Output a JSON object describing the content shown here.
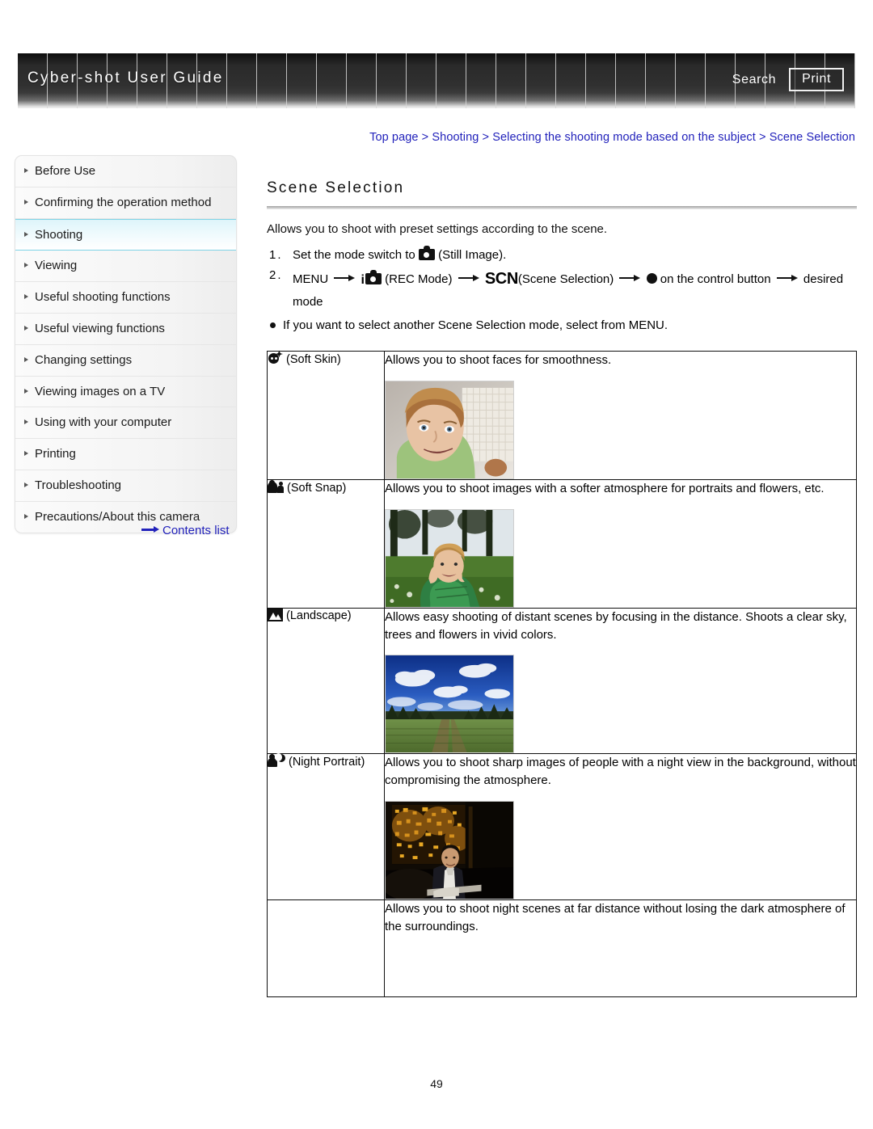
{
  "header": {
    "title": "Cyber-shot User Guide",
    "search_label": "Search",
    "print_label": "Print"
  },
  "breadcrumb": {
    "items": [
      "Top page",
      "Shooting",
      "Selecting the shooting mode based on the subject",
      "Scene Selection"
    ],
    "separator": " > ",
    "full_text": "Top page > Shooting > Selecting the shooting mode based on the subject > Scene Selection",
    "color": "#2222bb"
  },
  "sidebar": {
    "items": [
      {
        "label": "Before Use",
        "active": false
      },
      {
        "label": "Confirming the operation method",
        "active": false
      },
      {
        "label": "Shooting",
        "active": true
      },
      {
        "label": "Viewing",
        "active": false
      },
      {
        "label": "Useful shooting functions",
        "active": false
      },
      {
        "label": "Useful viewing functions",
        "active": false
      },
      {
        "label": "Changing settings",
        "active": false
      },
      {
        "label": "Viewing images on a TV",
        "active": false
      },
      {
        "label": "Using with your computer",
        "active": false
      },
      {
        "label": "Printing",
        "active": false
      },
      {
        "label": "Troubleshooting",
        "active": false
      },
      {
        "label": "Precautions/About this camera",
        "active": false
      }
    ],
    "contents_link": "Contents list",
    "active_color": "#7fd3e6"
  },
  "main": {
    "title": "Scene Selection",
    "intro": "Allows you to shoot with preset settings according to the scene.",
    "steps": [
      {
        "num": "1.",
        "before_icon": "Set the mode switch to",
        "icon": "camera-icon",
        "after_icon": "(Still Image)."
      },
      {
        "num": "2.",
        "p1": "MENU",
        "p2": "(REC Mode)",
        "p3": "(Scene Selection)",
        "p4": "on the control button",
        "p5": "desired mode",
        "scn_label": "SCN",
        "menu_label": "MENU"
      }
    ],
    "note": "If you want to select another Scene Selection mode, select from MENU."
  },
  "table": {
    "rows": [
      {
        "icon": "soft-skin-icon",
        "mode": "(Soft Skin)",
        "description": "Allows you to shoot faces for smoothness.",
        "has_thumb": true,
        "thumb": "child-face-photo"
      },
      {
        "icon": "soft-snap-icon",
        "mode": "(Soft Snap)",
        "description": "Allows you to shoot images with a softer atmosphere for portraits and flowers, etc.",
        "has_thumb": true,
        "thumb": "boy-in-grass-photo"
      },
      {
        "icon": "landscape-icon",
        "mode": "(Landscape)",
        "description": "Allows easy shooting of distant scenes by focusing in the distance. Shoots a clear sky, trees and flowers in vivid colors.",
        "has_thumb": true,
        "thumb": "landscape-sky-field-photo"
      },
      {
        "icon": "night-portrait-icon",
        "mode": "(Night Portrait)",
        "description": "Allows you to shoot sharp images of people with a night view in the background, without compromising the atmosphere.",
        "has_thumb": true,
        "thumb": "night-city-portrait-photo"
      },
      {
        "icon": "",
        "mode": "",
        "description": "Allows you to shoot night scenes at far distance without losing the dark atmosphere of the surroundings.",
        "has_thumb": false,
        "thumb": ""
      }
    ]
  },
  "footer": {
    "page_number": "49"
  }
}
